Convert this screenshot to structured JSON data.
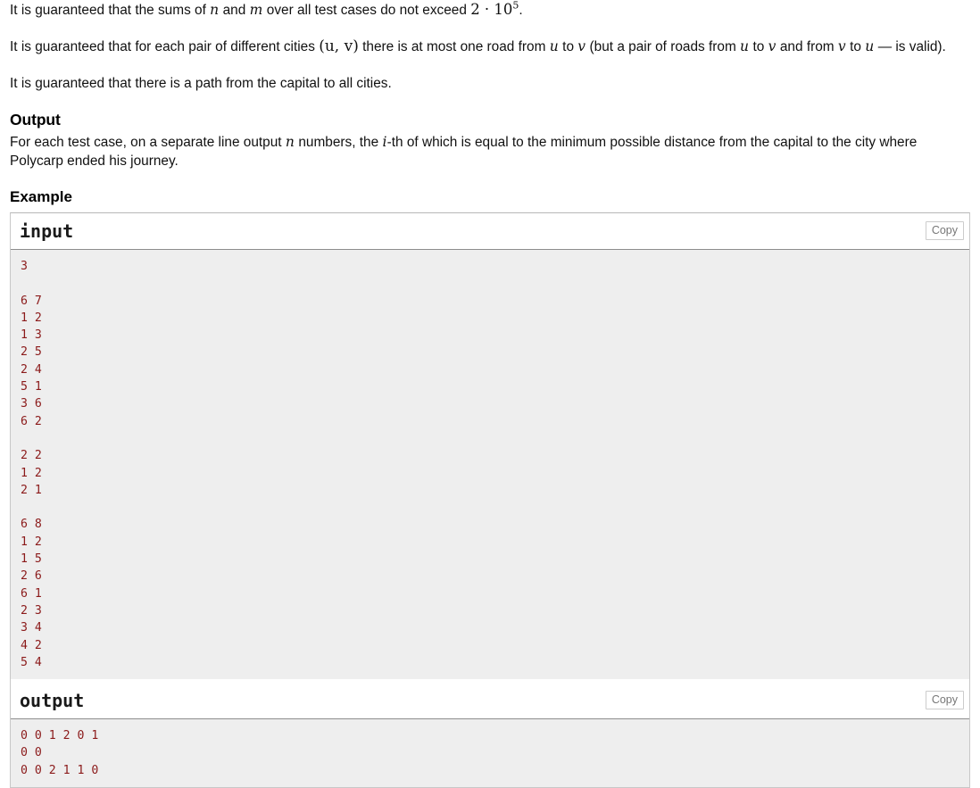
{
  "statements": {
    "p1_a": "It is guaranteed that the sums of ",
    "p1_n": "n",
    "p1_b": " and ",
    "p1_m": "m",
    "p1_c": " over all test cases do not exceed ",
    "p1_math_base": "2 · 10",
    "p1_math_exp": "5",
    "p1_d": ".",
    "p2_a": "It is guaranteed that for each pair of different cities ",
    "p2_uv": "(u, v)",
    "p2_b": " there is at most one road from ",
    "p2_u1": "u",
    "p2_c": " to ",
    "p2_v1": "v",
    "p2_d": " (but a pair of roads from ",
    "p2_u2": "u",
    "p2_e": " to ",
    "p2_v2": "v",
    "p2_f": " and from ",
    "p2_v3": "v",
    "p2_g": " to ",
    "p2_u3": "u",
    "p2_h": " — is valid).",
    "p3": "It is guaranteed that there is a path from the capital to all cities."
  },
  "output_section": {
    "heading": "Output",
    "text_a": "For each test case, on a separate line output ",
    "text_n": "n",
    "text_b": " numbers, the ",
    "text_i": "i",
    "text_c": "-th of which is equal to the minimum possible distance from the capital to the city where Polycarp ended his journey."
  },
  "example_section": {
    "heading": "Example",
    "input_label": "input",
    "output_label": "output",
    "copy_label": "Copy",
    "input_data": "3\n\n6 7\n1 2\n1 3\n2 5\n2 4\n5 1\n3 6\n6 2\n\n2 2\n1 2\n2 1\n\n6 8\n1 2\n1 5\n2 6\n6 1\n2 3\n3 4\n4 2\n5 4\n",
    "output_data": "0 0 1 2 0 1\n0 0\n0 0 2 1 1 0"
  },
  "colors": {
    "code_text": "#8b1a1a",
    "code_bg": "#eeeeee",
    "border": "#c8c8c8",
    "copy_text": "#777777"
  }
}
